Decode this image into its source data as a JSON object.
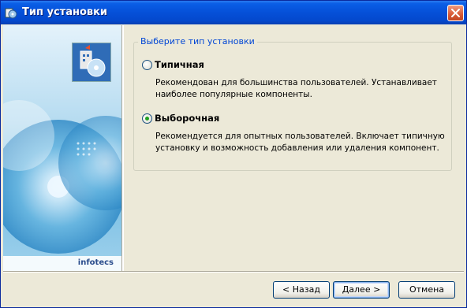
{
  "window": {
    "title": "Тип установки",
    "accent_color": "#0550d8"
  },
  "art_panel": {
    "brand": "infotecs"
  },
  "install_type": {
    "legend": "Выберите тип установки",
    "options": [
      {
        "label": "Типичная",
        "selected": false,
        "description_lines": [
          "Рекомендован для большинства пользователей. Устанавливает",
          "наиболее популярные компоненты."
        ]
      },
      {
        "label": "Выборочная",
        "selected": true,
        "description_lines": [
          "Рекомендуется для опытных пользователей. Включает типичную",
          "установку и возможность добавления или удаления компонент."
        ]
      }
    ]
  },
  "buttons": {
    "back": "< Назад",
    "next": "Далее >",
    "cancel": "Отмена"
  }
}
